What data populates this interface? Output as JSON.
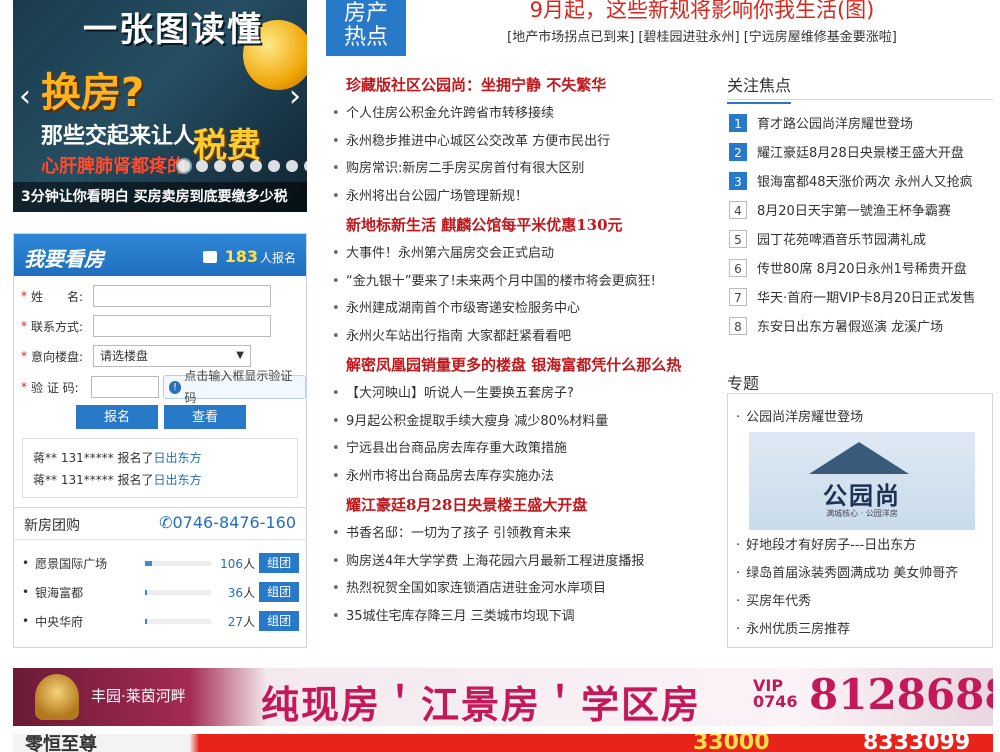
{
  "carousel": {
    "title": "一张图读懂",
    "headline": "换房?",
    "line2": "那些交起来让人",
    "tax": "税费",
    "line3": "心肝脾肺肾都疼的",
    "caption": "3分钟让你看明白 买房卖房到底要缴多少税",
    "prev_arrow": "‹",
    "next_arrow": "›"
  },
  "signup": {
    "title": "我要看房",
    "count": "183",
    "count_suffix": "人报名",
    "fields": {
      "name_label": "姓　　名:",
      "contact_label": "联系方式:",
      "property_label": "意向楼盘:",
      "property_selected": "请选楼盘",
      "captcha_label": "验 证 码:",
      "captcha_hint": "点击输入框显示验证码"
    },
    "submit_label": "报名",
    "view_label": "查看",
    "recent": [
      {
        "who": "蒋** 131***** 报名了",
        "place": "日出东方"
      },
      {
        "who": "蒋** 131***** 报名了",
        "place": "日出东方"
      }
    ]
  },
  "tuangou": {
    "title": "新房团购",
    "phone": "0746-8476-160",
    "items": [
      {
        "name": "愿景国际广场",
        "count": "106",
        "unit": "人",
        "fill": 0.1,
        "btn": "组团"
      },
      {
        "name": "银海富都",
        "count": "36",
        "unit": "人",
        "fill": 0.03,
        "btn": "组团"
      },
      {
        "name": "中央华府",
        "count": "27",
        "unit": "人",
        "fill": 0.02,
        "btn": "组团"
      }
    ]
  },
  "hot": {
    "badge_line1": "房产",
    "badge_line2": "热点",
    "headline": "9月起，这些新规将影响你我生活(图)",
    "sublinks": [
      "[地产市场拐点已到来]",
      "[碧桂园进驻永州]",
      "[宁远房屋维修基金要涨啦]"
    ]
  },
  "news": [
    {
      "title": "珍藏版社区公园尚：坐拥宁静  不失繁华",
      "items": [
        "个人住房公积金允许跨省市转移接续",
        "永州稳步推进中心城区公交改革 方便市民出行",
        "购房常识:新房二手房买房首付有很大区别",
        "永州将出台公园广场管理新规！"
      ]
    },
    {
      "title": "新地标新生活  麒麟公馆每平米优惠130元",
      "items": [
        "大事件！永州第六届房交会正式启动",
        "“金九银十”要来了!未来两个月中国的楼市将会更疯狂!",
        "永州建成湖南首个市级寄递安检服务中心",
        "永州火车站出行指南 大家都赶紧看看吧"
      ]
    },
    {
      "title": "解密凤凰园销量更多的楼盘 银海富都凭什么那么热",
      "items": [
        "【大河映山】听说人一生要换五套房子?",
        "9月起公积金提取手续大瘦身 减少80%材料量",
        "宁远县出台商品房去库存重大政策措施",
        "永州市将出台商品房去库存实施办法"
      ]
    },
    {
      "title": "耀江豪廷8月28日央景楼王盛大开盘",
      "items": [
        "书香名邸：一切为了孩子 引领教育未来",
        "购房送4年大学学费 上海花园六月最新工程进度播报",
        "热烈祝贺全国如家连锁酒店进驻金河水岸项目",
        "35城住宅库存降三月 三类城市均现下调"
      ]
    }
  ],
  "focus": {
    "title": "关注焦点",
    "items": [
      "育才路公园尚洋房耀世登场",
      "耀江豪廷8月28日央景楼王盛大开盘",
      "银海富都48天涨价两次 永州人又抢疯",
      "8月20日天宇第一號渔王杯争霸赛",
      "园丁花苑啤酒音乐节园满礼成",
      "传世80席 8月20日永州1号稀贵开盘",
      "华天·首府一期VIP卡8月20日正式发售",
      "东安日出东方暑假巡演 龙溪广场"
    ]
  },
  "topic": {
    "title": "专题",
    "first": "公园尚洋房耀世登场",
    "promo_logo": "公园尚",
    "promo_tag": "满城核心 · 公园洋房",
    "items": [
      "好地段才有好房子---日出东方",
      "绿岛首届泳装秀圆满成功 美女帅哥齐",
      "买房年代秀",
      "永州优质三房推荐"
    ]
  },
  "banner1": {
    "brand": "丰园·莱茵河畔",
    "slogan": "纯现房＇江景房＇学区房",
    "vip": "VIP",
    "area": "0746",
    "tel": "8128688"
  },
  "banner2": {
    "brand": "零恒至尊",
    "num": "33000",
    "tel": "8333099"
  }
}
